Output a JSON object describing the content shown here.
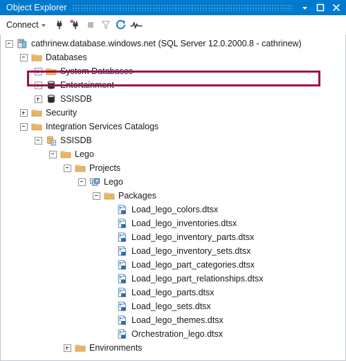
{
  "window": {
    "title": "Object Explorer",
    "controls": [
      {
        "name": "dropdown-icon",
        "glyph": "chevron-down"
      },
      {
        "name": "maximize-icon",
        "glyph": "square"
      },
      {
        "name": "close-icon",
        "glyph": "x"
      }
    ]
  },
  "toolbar": {
    "connect_label": "Connect",
    "items": [
      {
        "name": "connect-object-explorer-icon",
        "title": "Connect"
      },
      {
        "name": "disconnect-object-explorer-icon",
        "title": "Disconnect"
      },
      {
        "name": "stop-icon",
        "title": "Stop",
        "disabled": true
      },
      {
        "name": "filter-icon",
        "title": "Filter",
        "disabled": true
      },
      {
        "name": "refresh-icon",
        "title": "Refresh"
      },
      {
        "name": "activity-monitor-icon",
        "title": "Activity Monitor"
      }
    ]
  },
  "highlight_color": "#9e0b4d",
  "tree": {
    "nodes": [
      {
        "label": "cathrinew.database.windows.net (SQL Server 12.0.2000.8 - cathrinew)",
        "depth": 0,
        "state": "expanded",
        "icon": "server",
        "highlighted": true
      },
      {
        "label": "Databases",
        "depth": 1,
        "state": "expanded",
        "icon": "folder"
      },
      {
        "label": "System Databases",
        "depth": 2,
        "state": "collapsed",
        "icon": "folder"
      },
      {
        "label": "Entertainment",
        "depth": 2,
        "state": "collapsed",
        "icon": "database"
      },
      {
        "label": "SSISDB",
        "depth": 2,
        "state": "collapsed",
        "icon": "database"
      },
      {
        "label": "Security",
        "depth": 1,
        "state": "collapsed",
        "icon": "folder"
      },
      {
        "label": "Integration Services Catalogs",
        "depth": 1,
        "state": "expanded",
        "icon": "folder"
      },
      {
        "label": "SSISDB",
        "depth": 2,
        "state": "expanded",
        "icon": "catalog"
      },
      {
        "label": "Lego",
        "depth": 3,
        "state": "expanded",
        "icon": "folder"
      },
      {
        "label": "Projects",
        "depth": 4,
        "state": "expanded",
        "icon": "folder"
      },
      {
        "label": "Lego",
        "depth": 5,
        "state": "expanded",
        "icon": "project"
      },
      {
        "label": "Packages",
        "depth": 6,
        "state": "expanded",
        "icon": "folder"
      },
      {
        "label": "Load_lego_colors.dtsx",
        "depth": 7,
        "state": "leaf",
        "icon": "package"
      },
      {
        "label": "Load_lego_inventories.dtsx",
        "depth": 7,
        "state": "leaf",
        "icon": "package"
      },
      {
        "label": "Load_lego_inventory_parts.dtsx",
        "depth": 7,
        "state": "leaf",
        "icon": "package"
      },
      {
        "label": "Load_lego_inventory_sets.dtsx",
        "depth": 7,
        "state": "leaf",
        "icon": "package"
      },
      {
        "label": "Load_lego_part_categories.dtsx",
        "depth": 7,
        "state": "leaf",
        "icon": "package"
      },
      {
        "label": "Load_lego_part_relationships.dtsx",
        "depth": 7,
        "state": "leaf",
        "icon": "package"
      },
      {
        "label": "Load_lego_parts.dtsx",
        "depth": 7,
        "state": "leaf",
        "icon": "package"
      },
      {
        "label": "Load_lego_sets.dtsx",
        "depth": 7,
        "state": "leaf",
        "icon": "package"
      },
      {
        "label": "Load_lego_themes.dtsx",
        "depth": 7,
        "state": "leaf",
        "icon": "package"
      },
      {
        "label": "Orchestration_lego.dtsx",
        "depth": 7,
        "state": "leaf",
        "icon": "package"
      },
      {
        "label": "Environments",
        "depth": 4,
        "state": "collapsed",
        "icon": "folder"
      }
    ]
  }
}
